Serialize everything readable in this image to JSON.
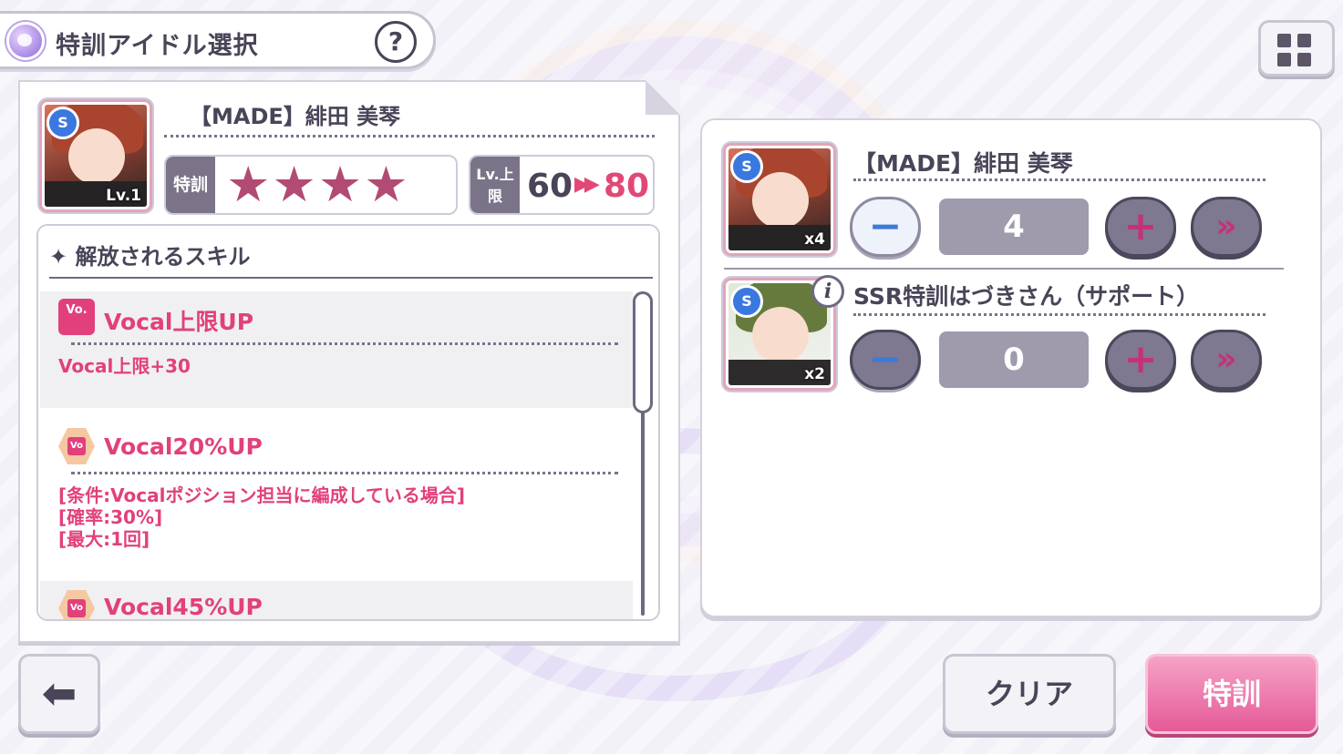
{
  "header": {
    "title": "特訓アイドル選択",
    "help_label": "?"
  },
  "left": {
    "card": {
      "name": "【MADE】緋田 美琴",
      "level_badge": "Lv.1",
      "rarity_badge": "S"
    },
    "training": {
      "label": "特訓",
      "stars": "★★★★",
      "stars_count": 4
    },
    "level_cap": {
      "label": "Lv.上限",
      "from": "60",
      "arrow": "▶▶",
      "to": "80"
    },
    "skills": {
      "header": "✦ 解放されるスキル",
      "items": [
        {
          "icon": "vocal-cap-up-icon",
          "icon_text": "Vo.",
          "name": "Vocal上限UP",
          "desc": "Vocal上限+30"
        },
        {
          "icon": "vocal-up-icon",
          "name": "Vocal20%UP",
          "desc": "[条件:Vocalポジション担当に編成している場合]\n[確率:30%]\n[最大:1回]"
        },
        {
          "icon": "vocal-up-icon",
          "name": "Vocal45%UP"
        }
      ]
    }
  },
  "right": {
    "rows": [
      {
        "name": "【MADE】緋田 美琴",
        "count_label": "x4",
        "quantity": "4",
        "badge": "S"
      },
      {
        "name": "SSR特訓はづきさん（サポート）",
        "count_label": "x2",
        "quantity": "0",
        "badge": "S",
        "info": "i"
      }
    ],
    "minus": "−",
    "plus": "+",
    "ff": "»"
  },
  "bottom": {
    "back_label": "⬅",
    "clear_label": "クリア",
    "train_label": "特訓"
  },
  "colors": {
    "accent": "#e2407c",
    "panel_border": "#cfcbd8",
    "dark_text": "#4a4458"
  }
}
